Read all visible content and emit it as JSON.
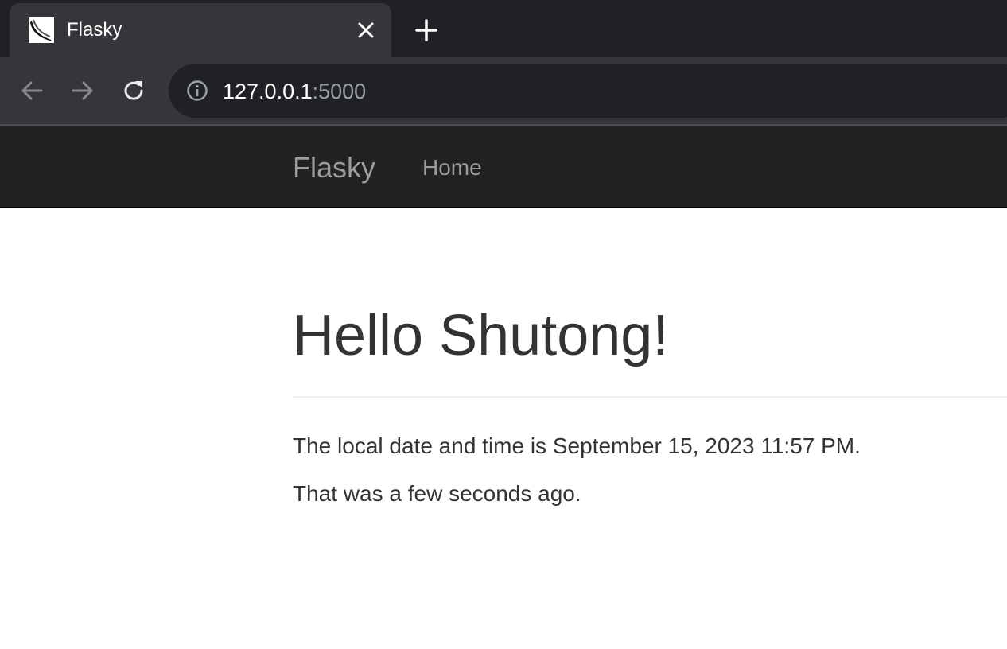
{
  "browser": {
    "tab": {
      "title": "Flasky"
    },
    "address_bar": {
      "host": "127.0.0.1",
      "port": ":5000"
    }
  },
  "navbar": {
    "brand": "Flasky",
    "links": [
      {
        "label": "Home"
      }
    ]
  },
  "main": {
    "heading": "Hello Shutong!",
    "paragraphs": [
      "The local date and time is September 15, 2023 11:57 PM.",
      "That was a few seconds ago."
    ]
  },
  "colors": {
    "chrome_dark": "#202124",
    "chrome_tab": "#35363a",
    "navbar_bg": "#222222",
    "navbar_text": "#9d9d9d",
    "body_text": "#333333"
  },
  "icons": {
    "tab_favicon": "flask-horn-icon",
    "tab_close": "close-icon",
    "new_tab": "plus-icon",
    "back": "arrow-left-icon",
    "forward": "arrow-right-icon",
    "reload": "reload-icon",
    "site_info": "info-icon"
  }
}
